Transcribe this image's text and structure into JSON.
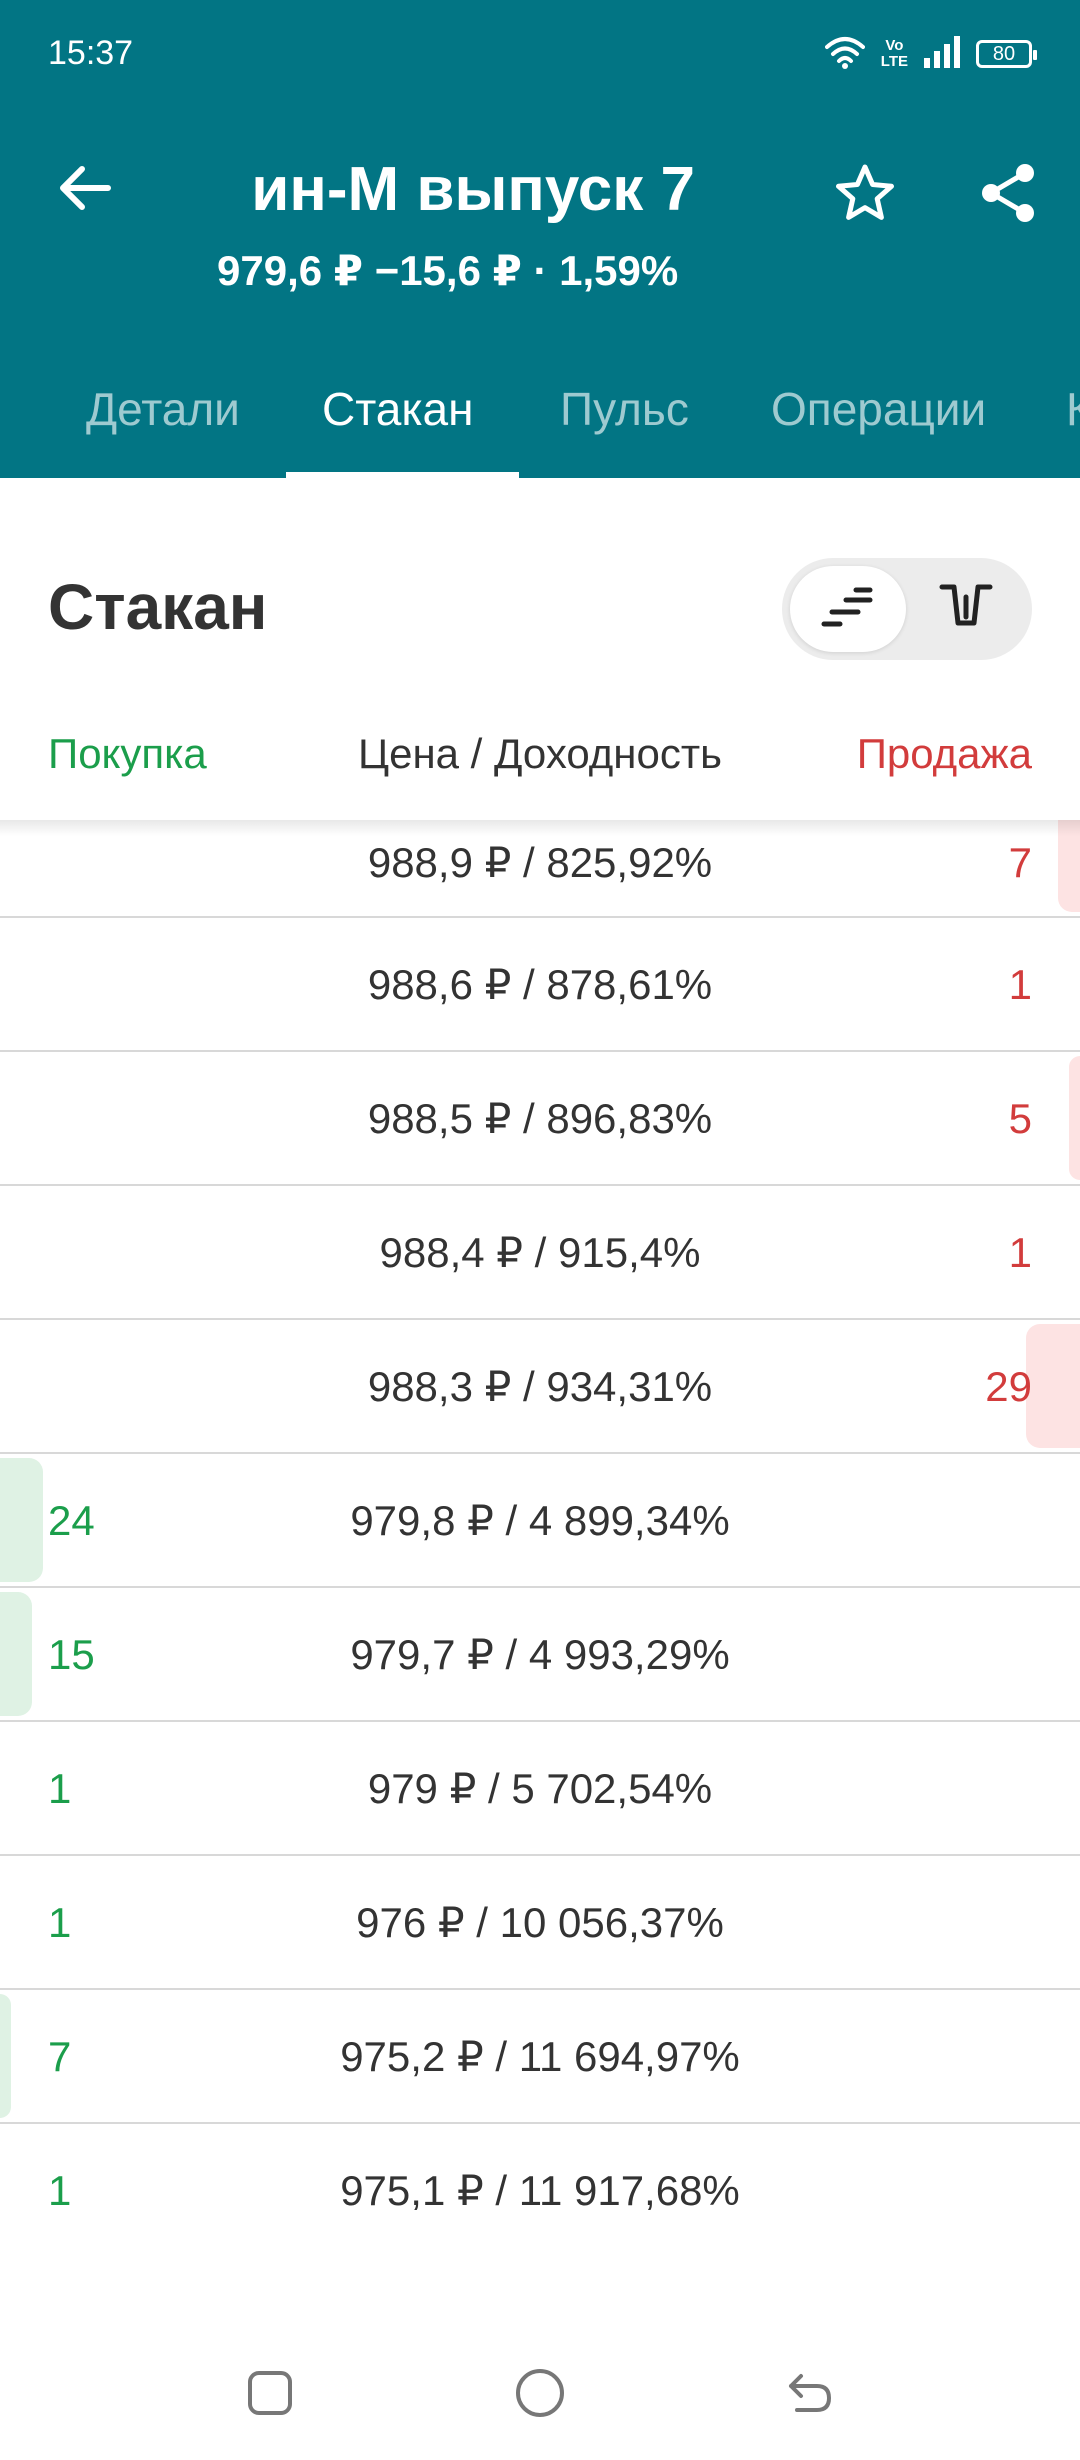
{
  "status_bar": {
    "time": "15:37",
    "volte_top": "Vo",
    "volte_bottom": "LTE",
    "battery": "80"
  },
  "header": {
    "title": "ин-М выпуск 7",
    "subtitle": "979,6 ₽  −15,6 ₽ · 1,59%",
    "bg_color": "#027584"
  },
  "tabs": [
    {
      "label": "Детали",
      "active": false
    },
    {
      "label": "Стакан",
      "active": true
    },
    {
      "label": "Пульс",
      "active": false
    },
    {
      "label": "Операции",
      "active": false
    },
    {
      "label": "К",
      "active": false
    }
  ],
  "section": {
    "title": "Стакан"
  },
  "columns": {
    "buy": "Покупка",
    "price": "Цена / Доходность",
    "sell": "Продажа"
  },
  "colors": {
    "buy": "#1b9e4b",
    "sell": "#d23c3c"
  },
  "rows": [
    {
      "side": "sell",
      "price": "988,9 ₽ / 825,92%",
      "qty": "7",
      "volume_fraction": 0.02
    },
    {
      "side": "sell",
      "price": "988,6 ₽ / 878,61%",
      "qty": "1",
      "volume_fraction": 0.0
    },
    {
      "side": "sell",
      "price": "988,5 ₽ / 896,83%",
      "qty": "5",
      "volume_fraction": 0.01
    },
    {
      "side": "sell",
      "price": "988,4 ₽ / 915,4%",
      "qty": "1",
      "volume_fraction": 0.0
    },
    {
      "side": "sell",
      "price": "988,3 ₽ / 934,31%",
      "qty": "29",
      "volume_fraction": 0.05
    },
    {
      "side": "buy",
      "price": "979,8 ₽ / 4 899,34%",
      "qty": "24",
      "volume_fraction": 0.04
    },
    {
      "side": "buy",
      "price": "979,7 ₽ / 4 993,29%",
      "qty": "15",
      "volume_fraction": 0.03
    },
    {
      "side": "buy",
      "price": "979 ₽ / 5 702,54%",
      "qty": "1",
      "volume_fraction": 0.0
    },
    {
      "side": "buy",
      "price": "976 ₽ / 10 056,37%",
      "qty": "1",
      "volume_fraction": 0.0
    },
    {
      "side": "buy",
      "price": "975,2 ₽ / 11 694,97%",
      "qty": "7",
      "volume_fraction": 0.01
    },
    {
      "side": "buy",
      "price": "975,1 ₽ / 11 917,68%",
      "qty": "1",
      "volume_fraction": 0.0
    }
  ],
  "icons": {
    "back": "arrow-left-icon",
    "favorite": "star-outline-icon",
    "share": "share-icon",
    "toggle_list": "orderbook-list-icon",
    "toggle_chart": "depth-chart-icon"
  }
}
